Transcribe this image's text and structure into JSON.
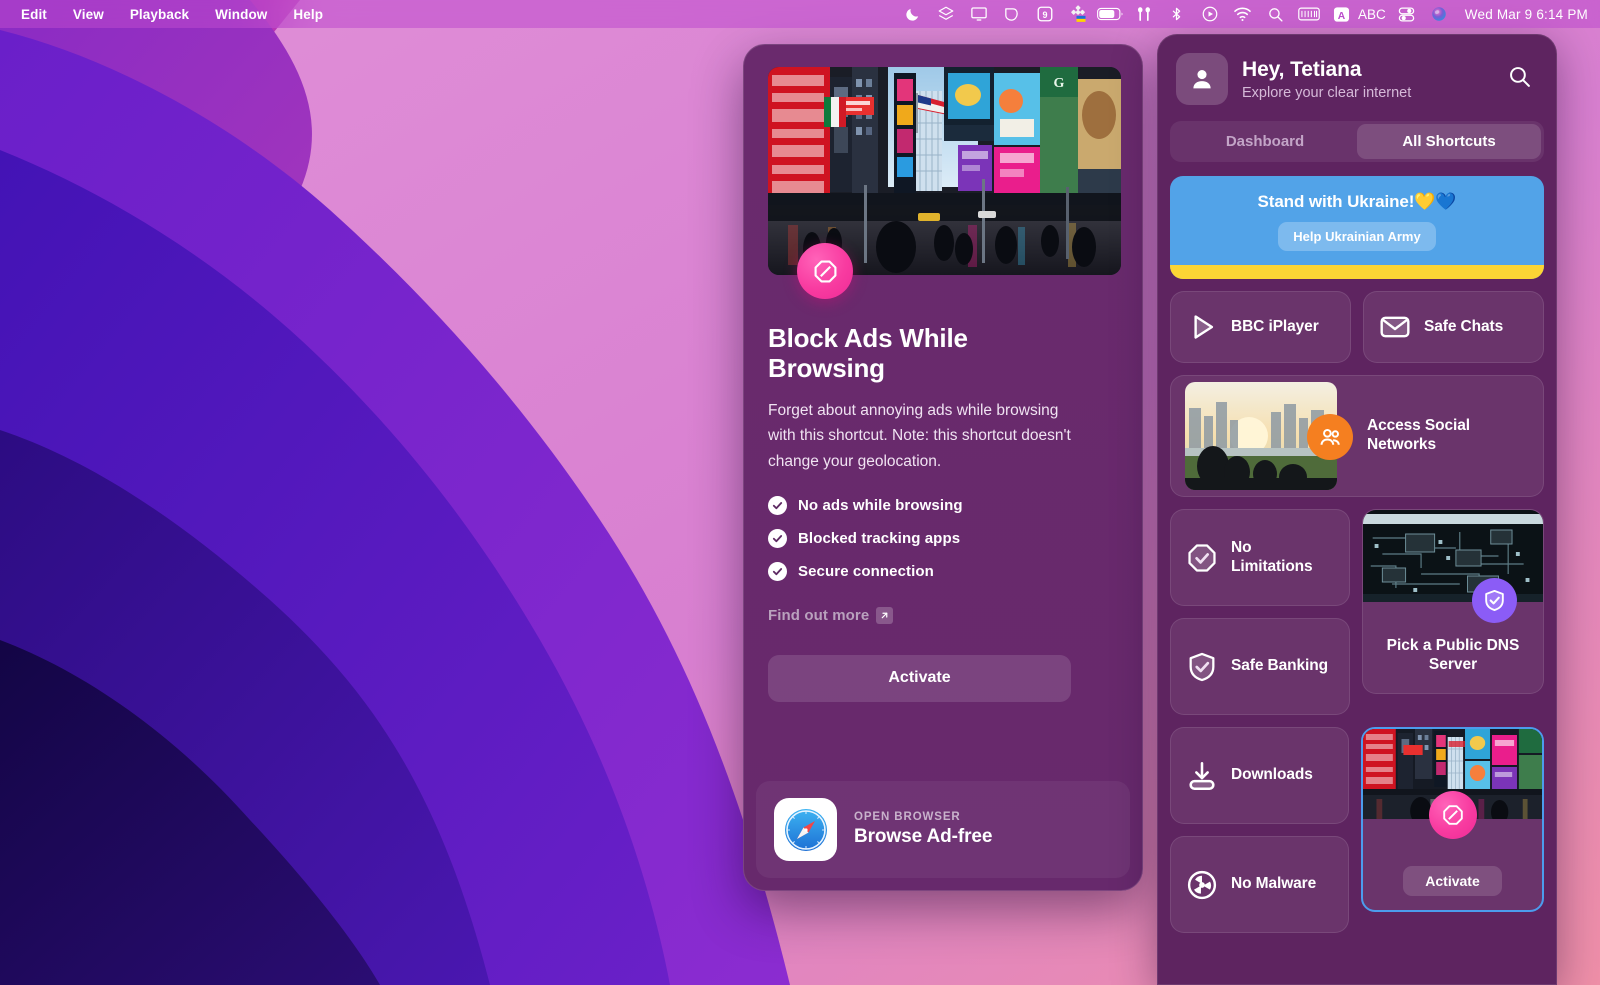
{
  "menubar": {
    "menus": [
      "Edit",
      "View",
      "Playback",
      "Window",
      "Help"
    ],
    "tray_icons": [
      "moon-icon",
      "layers-icon",
      "display-icon",
      "shield-tag-icon",
      "nine-box-icon",
      "ukraine-flag-icon",
      "battery-icon",
      "airpods-icon",
      "bluetooth-icon",
      "play-circle-icon",
      "wifi-icon",
      "search-icon",
      "keyboard-icon",
      "input-source-icon",
      "control-center-icon",
      "siri-icon"
    ],
    "input_source_label": "ABC",
    "clock": "Wed Mar 9  6:14 PM"
  },
  "main_card": {
    "hero_alt": "times-square-billboards-photo",
    "badge_icon": "block-ads-octagon-icon",
    "title": "Block Ads While Browsing",
    "description": "Forget about annoying ads while browsing with this shortcut. Note: this shortcut doesn't change your geolocation.",
    "features": [
      "No ads while browsing",
      "Blocked tracking apps",
      "Secure connection"
    ],
    "find_out_more": "Find out more",
    "find_out_more_icon": "external-link-icon",
    "activate_label": "Activate",
    "footer": {
      "app_icon": "safari-icon",
      "kicker": "OPEN BROWSER",
      "title": "Browse Ad-free"
    }
  },
  "sidebar": {
    "avatar_icon": "person-icon",
    "greeting": "Hey, Tetiana",
    "subgreeting": "Explore your clear internet",
    "search_icon": "search-icon",
    "tabs": [
      {
        "label": "Dashboard",
        "active": false
      },
      {
        "label": "All Shortcuts",
        "active": true
      }
    ],
    "banner": {
      "title": "Stand with Ukraine!💛💙",
      "button": "Help Ukrainian Army",
      "bg_color": "#52a3e8",
      "stripe_color": "#fcd535"
    },
    "shortcuts": [
      {
        "label": "BBC iPlayer",
        "icon": "play-triangle-icon",
        "kind": "half"
      },
      {
        "label": "Safe Chats",
        "icon": "envelope-icon",
        "kind": "half"
      },
      {
        "label": "Access Social Networks",
        "icon": "people-icon",
        "kind": "full",
        "thumb": "friends-city-sunset-photo",
        "badge_color": "#f57f20"
      },
      {
        "label": "No Limitations",
        "icon": "octagon-check-icon",
        "kind": "stack"
      },
      {
        "label": "Safe Banking",
        "icon": "shield-check-icon",
        "kind": "stack"
      },
      {
        "label": "Pick a Public DNS Server",
        "icon": "shield-check-icon",
        "kind": "tall",
        "thumb": "circuit-board-photo",
        "badge_color": "#8b5cf6"
      },
      {
        "label": "Downloads",
        "icon": "download-icon",
        "kind": "stack"
      },
      {
        "label": "No Malware",
        "icon": "radiation-icon",
        "kind": "stack"
      },
      {
        "label": "Activate",
        "icon": "block-ads-octagon-icon",
        "kind": "tall-selected",
        "thumb": "times-square-billboards-photo",
        "badge_color": "#f83ba0",
        "selected_border": "#4c9ced"
      }
    ]
  }
}
